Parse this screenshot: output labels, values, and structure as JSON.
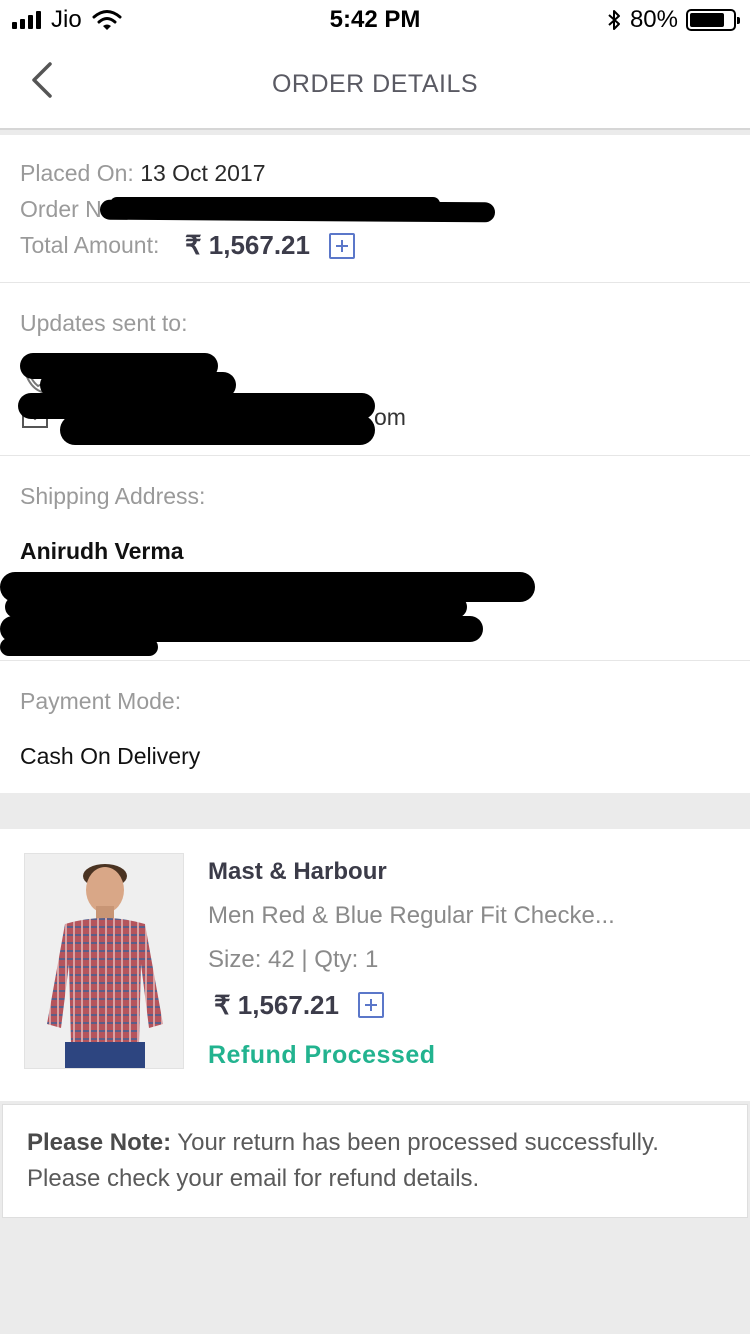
{
  "status_bar": {
    "carrier": "Jio",
    "time": "5:42 PM",
    "battery_percent": "80%",
    "battery_level": 0.8
  },
  "nav": {
    "title": "ORDER DETAILS"
  },
  "order": {
    "placed_on_label": "Placed On:",
    "placed_on_value": "13 Oct 2017",
    "order_no_label": "Order N",
    "total_label": "Total Amount:",
    "total_value": "₹ 1,567.21"
  },
  "updates": {
    "label": "Updates sent to:",
    "email_suffix": "om"
  },
  "shipping": {
    "label": "Shipping Address:",
    "name": "Anirudh Verma"
  },
  "payment": {
    "label": "Payment Mode:",
    "value": "Cash On Delivery"
  },
  "item": {
    "brand": "Mast & Harbour",
    "name": "Men Red & Blue Regular Fit Checke...",
    "size_qty": "Size: 42 | Qty: 1",
    "price": "₹ 1,567.21",
    "status": "Refund Processed"
  },
  "note": {
    "title": "Please Note:",
    "text": "Your return has been processed successfully. Please check your email for refund details."
  },
  "colors": {
    "accent_blue": "#5b77c9",
    "status_green": "#22b38f"
  },
  "icons": [
    "back-arrow-icon",
    "plus-box-icon",
    "phone-icon",
    "mail-icon",
    "wifi-icon",
    "bluetooth-icon",
    "battery-icon"
  ]
}
